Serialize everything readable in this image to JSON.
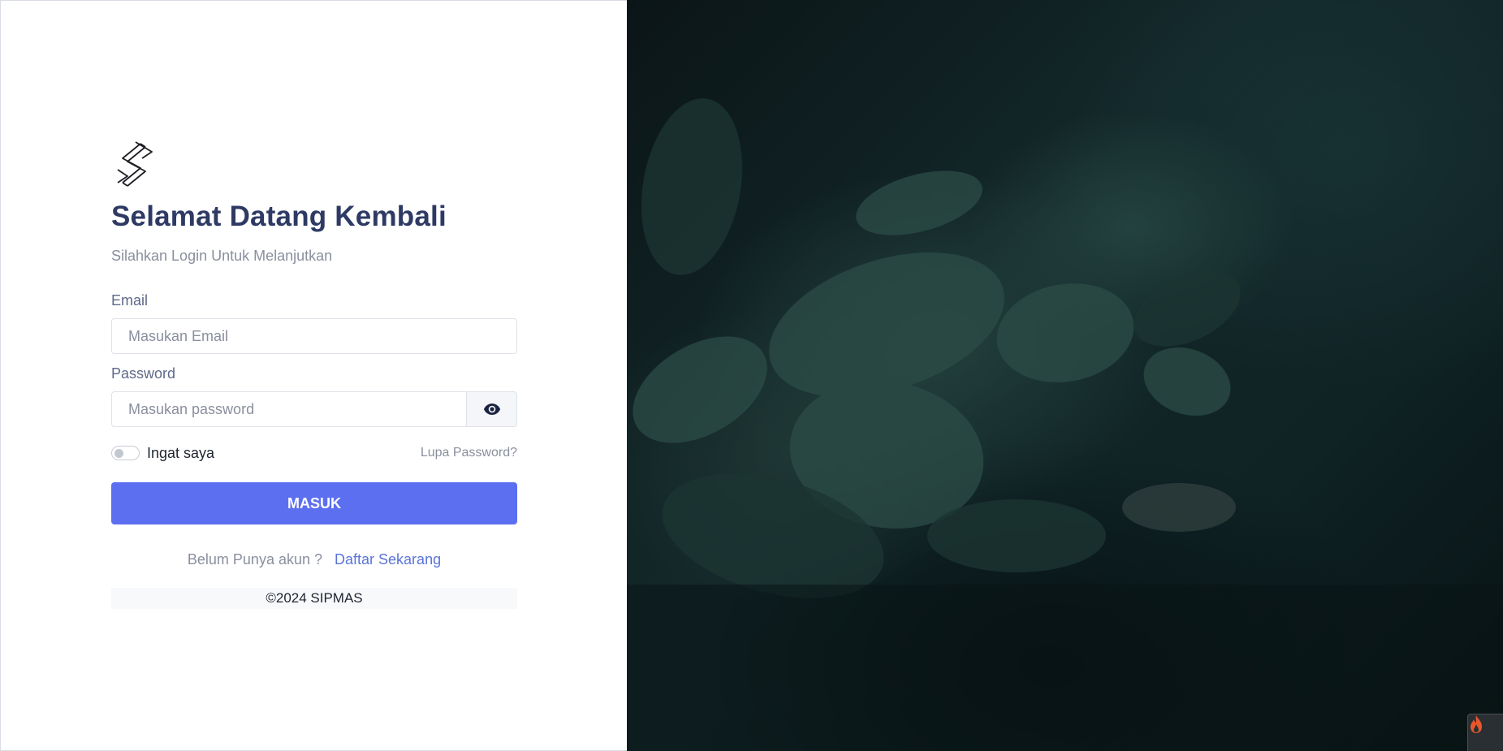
{
  "login": {
    "title": "Selamat Datang Kembali",
    "subtitle": "Silahkan Login Untuk Melanjutkan",
    "email_label": "Email",
    "email_placeholder": "Masukan Email",
    "password_label": "Password",
    "password_placeholder": "Masukan password",
    "remember_label": "Ingat saya",
    "remember_checked": false,
    "forgot_label": "Lupa Password?",
    "submit_label": "MASUK",
    "register_prompt": "Belum Punya akun ?",
    "register_link": "Daftar Sekarang",
    "footer": "©2024 SIPMAS"
  },
  "icons": {
    "logo": "logo-icon",
    "password_toggle": "eye-icon",
    "corner": "flame-icon"
  },
  "colors": {
    "title": "#2e3a63",
    "primary_button": "#5d6ff1",
    "link": "#5a74d8",
    "muted_text": "#8a8f9e"
  }
}
